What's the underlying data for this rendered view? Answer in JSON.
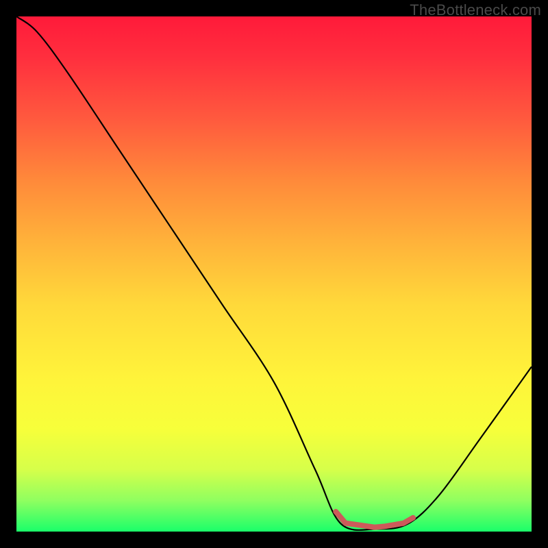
{
  "watermark": "TheBottleneck.com",
  "colors": {
    "background": "#000000",
    "gradient_top": "#ff1a3a",
    "gradient_bottom": "#1aff6a",
    "curve": "#000000",
    "marker": "#cc5a5a"
  },
  "chart_data": {
    "type": "line",
    "title": "",
    "xlabel": "",
    "ylabel": "",
    "xlim": [
      0,
      100
    ],
    "ylim": [
      0,
      100
    ],
    "note": "Normalized; 0=bottom/left, 100=top/right. Curve descends from upper-left, reaches a broad minimum near x≈63–76 (y≈0), then rises toward the right edge to about y≈32.",
    "series": [
      {
        "name": "bottleneck-curve",
        "x": [
          0,
          4,
          10,
          20,
          30,
          40,
          50,
          58,
          63,
          70,
          76,
          82,
          90,
          100
        ],
        "y": [
          100,
          97,
          89,
          74,
          59,
          44,
          29,
          12,
          1.5,
          0.5,
          1.5,
          7,
          18,
          32
        ]
      }
    ],
    "annotations": [
      {
        "type": "segment-marker",
        "description": "thick reddish marker along curve near the minimum",
        "x_start": 62,
        "x_end": 77,
        "y": 1
      }
    ]
  }
}
